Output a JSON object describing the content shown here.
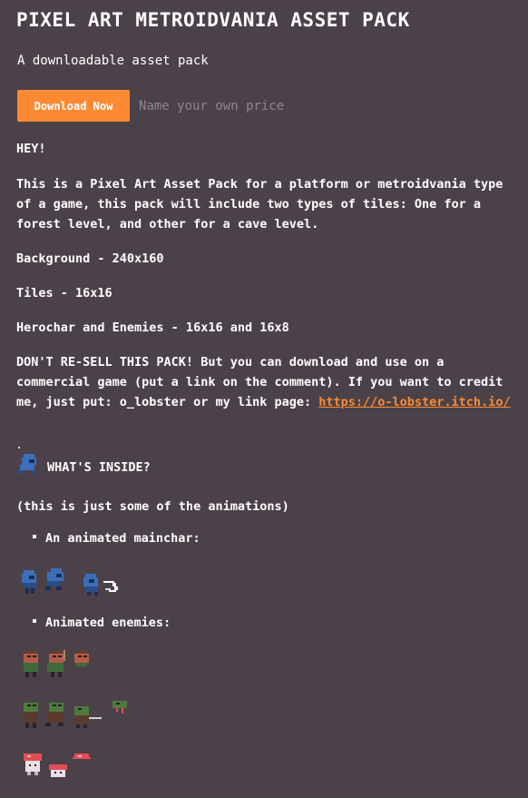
{
  "title": "PIXEL ART METROIDVANIA ASSET PACK",
  "subtitle": "A downloadable asset pack",
  "buy": {
    "button_label": "Download Now",
    "price_hint": "Name your own price"
  },
  "description": {
    "greeting": "HEY!",
    "intro": "This is a Pixel Art Asset Pack for a platform or metroidvania type of a game, this pack will include two types of tiles: One for a forest level, and other for a cave level.",
    "background": "Background -  240x160",
    "tiles": "Tiles - 16x16",
    "chars": "Herochar and Enemies - 16x16 and 16x8",
    "license_text": "DON'T RE-SELL THIS PACK! But you can download and use on a commercial game (put a link on the comment). If you want to credit me, just put: o_lobster or my link page: ",
    "license_link": "https://o-lobster.itch.io/",
    "whats_inside": "WHAT'S INSIDE?",
    "note": "(this is just some of the animations)",
    "bullet_mainchar": "An animated mainchar:",
    "bullet_enemies": "Animated enemies:"
  },
  "colors": {
    "background": "#4b4249",
    "accent": "#fb8a33",
    "muted_text": "#8f868d",
    "hero_blue": "#3d6fb8",
    "goblin_green": "#3f6b3a",
    "mushroom_red": "#e34d57"
  }
}
